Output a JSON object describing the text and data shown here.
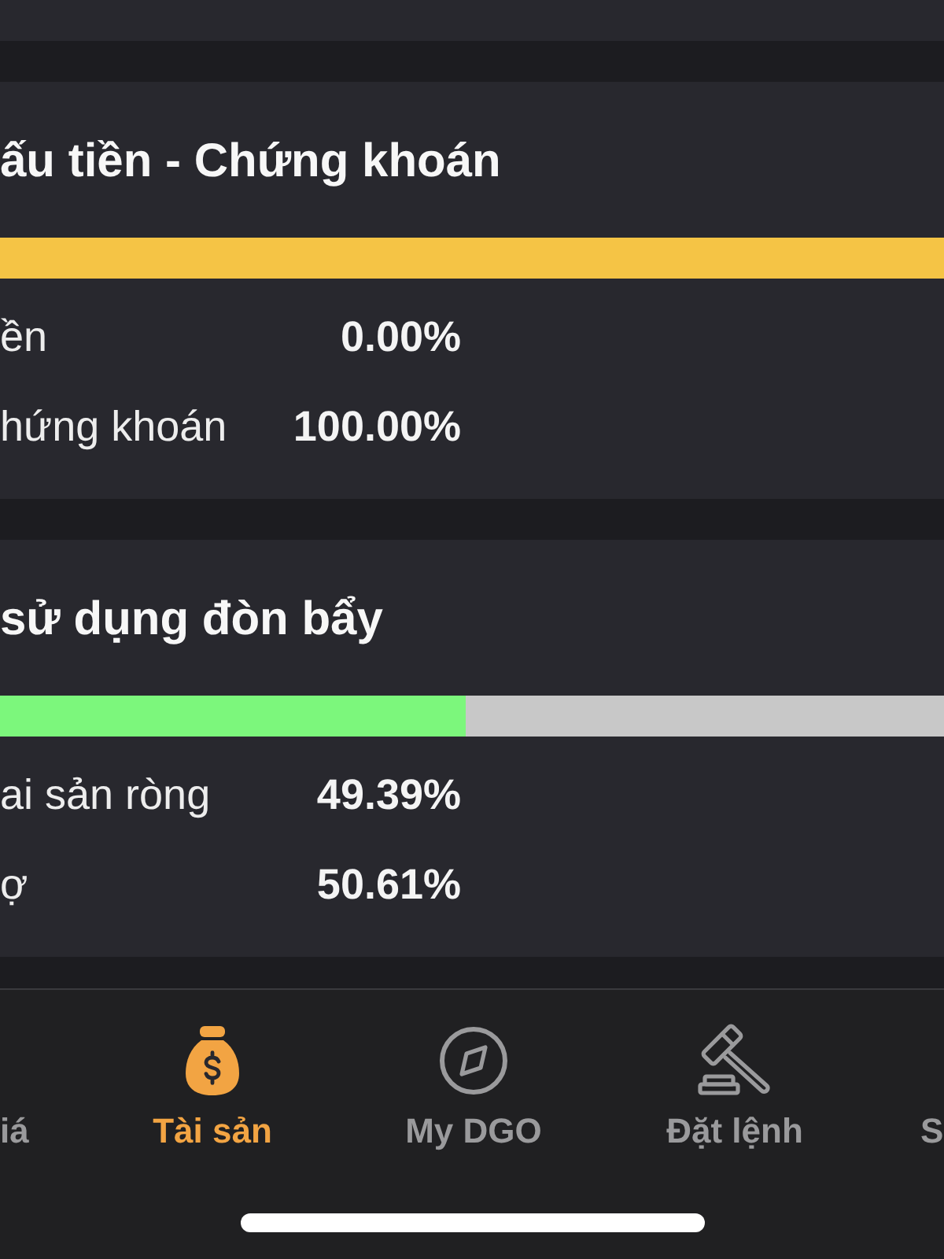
{
  "cards": [
    {
      "title": "ấu tiền - Chứng khoán",
      "bar": {
        "level": 1,
        "color": "#f5c445"
      },
      "rows": [
        {
          "label": "ền",
          "value": "0.00%"
        },
        {
          "label": "hứng khoán",
          "value": "100.00%"
        }
      ]
    },
    {
      "title": "sử dụng đòn bẩy",
      "bar": {
        "level": 0.4939,
        "color": "#7cf77c"
      },
      "rows": [
        {
          "label": "ai sản ròng",
          "value": "49.39%"
        },
        {
          "label": "ợ",
          "value": "50.61%"
        }
      ]
    }
  ],
  "bottom_nav": {
    "items": [
      {
        "label": "iá",
        "selected": false
      },
      {
        "label": "Tài sản",
        "selected": true
      },
      {
        "label": "My DGO",
        "selected": false
      },
      {
        "label": "Đặt lệnh",
        "selected": false
      },
      {
        "label": "S",
        "selected": false
      }
    ]
  }
}
